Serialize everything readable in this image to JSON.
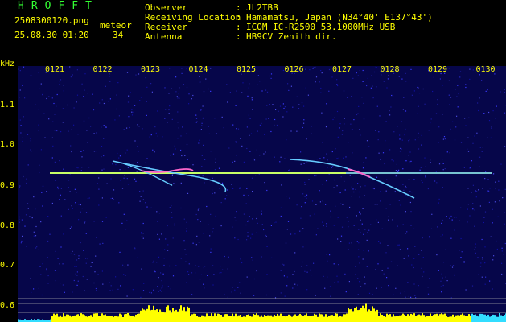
{
  "header": {
    "app_title": "HROFFT",
    "file_name": "2508300120.png",
    "datetime": "25.08.30 01:20",
    "meteor_label": "meteor",
    "meteor_count": "34",
    "info": [
      {
        "label": "Observer",
        "value": "JL2TBB"
      },
      {
        "label": "Receiving Location",
        "value": "Hamamatsu, Japan (N34°40' E137°43')"
      },
      {
        "label": "Receiver",
        "value": "ICOM IC-R2500 53.1000MHz USB"
      },
      {
        "label": "Antenna",
        "value": "HB9CV Zenith dir."
      }
    ]
  },
  "axis": {
    "unit": "kHz",
    "time_ticks": [
      "0121",
      "0122",
      "0123",
      "0124",
      "0125",
      "0126",
      "0127",
      "0128",
      "0129",
      "0130"
    ],
    "freq_ticks": [
      "1.1",
      "1.0",
      "0.9",
      "0.8",
      "0.7",
      "0.6"
    ]
  },
  "colors": {
    "background": "#000000",
    "plot_bg": "#06064a",
    "text_primary": "#ffff00",
    "title": "#33ff33",
    "info_text": "#ffffff",
    "carrier": "#c8ff66",
    "echo": "#66ccff",
    "level_bar": "#ffff00",
    "level_low": "#33ddff"
  }
}
